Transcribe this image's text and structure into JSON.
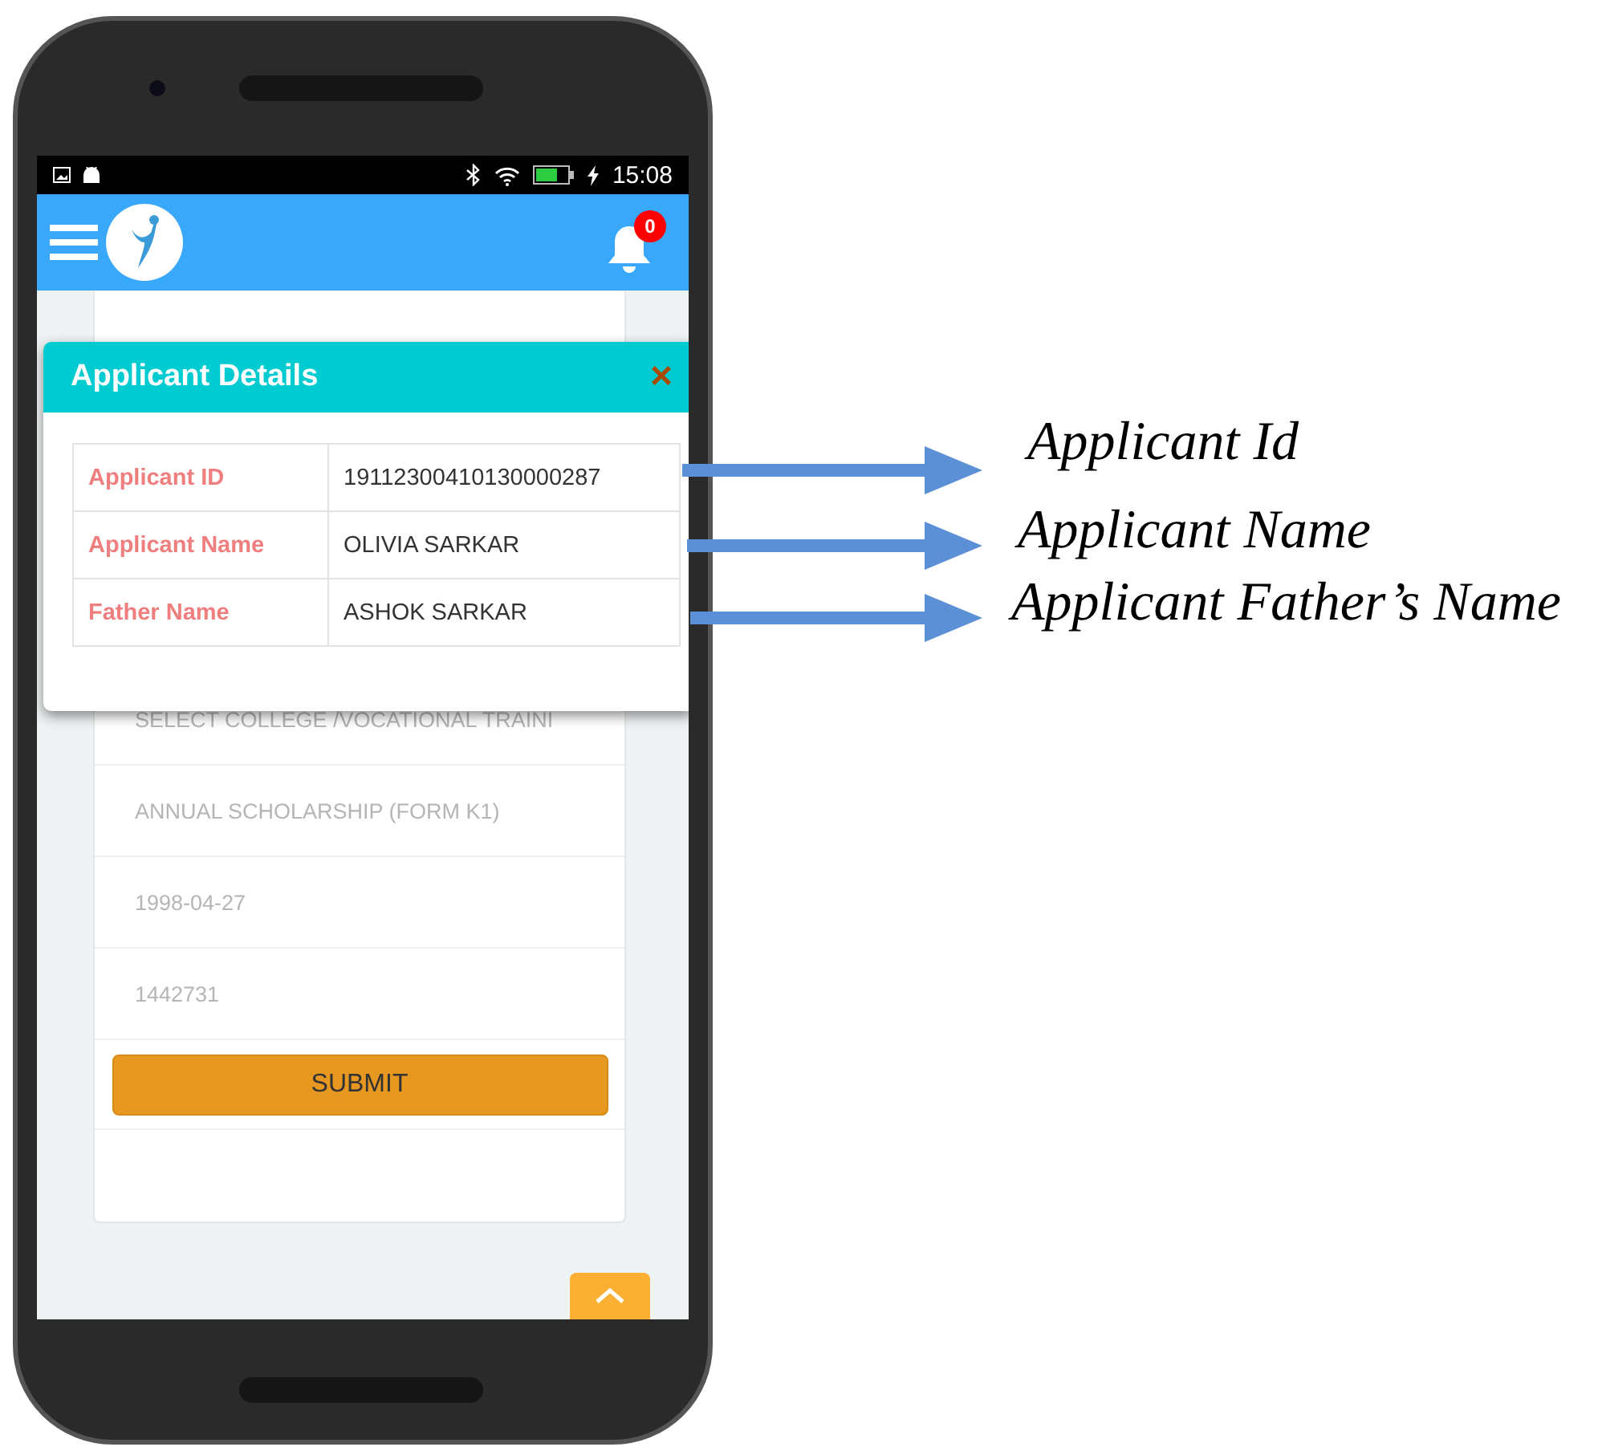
{
  "status_bar": {
    "time": "15:08"
  },
  "app_bar": {
    "notification_count": "0"
  },
  "form": {
    "fields": [
      "SELECT COLLEGE /VOCATIONAL TRAINI",
      "ANNUAL SCHOLARSHIP (FORM K1)",
      "1998-04-27",
      "1442731"
    ],
    "submit": "SUBMIT"
  },
  "dialog": {
    "title": "Applicant Details",
    "close": "×",
    "rows": [
      {
        "label": "Applicant ID",
        "value": "19112300410130000287"
      },
      {
        "label": "Applicant Name",
        "value": "OLIVIA SARKAR"
      },
      {
        "label": "Father Name",
        "value": "ASHOK SARKAR"
      }
    ]
  },
  "annotations": [
    "Applicant Id",
    "Applicant Name",
    "Applicant Father’s Name"
  ]
}
